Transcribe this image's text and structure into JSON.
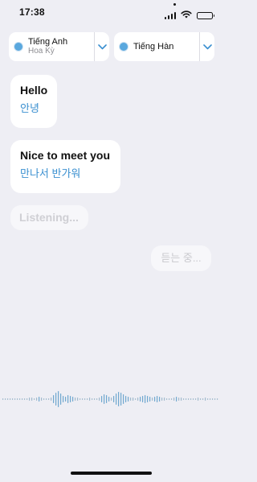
{
  "status_bar": {
    "time": "17:38",
    "icons": [
      "signal-icon",
      "wifi-icon",
      "battery-icon"
    ],
    "battery_fraction": 1.0
  },
  "languages": {
    "source": {
      "name": "Tiếng Anh",
      "region": "Hoa Kỳ"
    },
    "target": {
      "name": "Tiếng Hàn"
    },
    "chevron_icon": "chevron-down-icon",
    "dot_color": "#5aa8de"
  },
  "conversation": [
    {
      "source": "Hello",
      "translation": "안녕"
    },
    {
      "source": "Nice to meet you",
      "translation": "만나서 반가워"
    }
  ],
  "listening": {
    "source_placeholder": "Listening...",
    "target_placeholder": "듣는 중..."
  },
  "colors": {
    "background": "#eeeef4",
    "accent": "#3a8fd0",
    "placeholder_text": "#cfcfd4"
  }
}
